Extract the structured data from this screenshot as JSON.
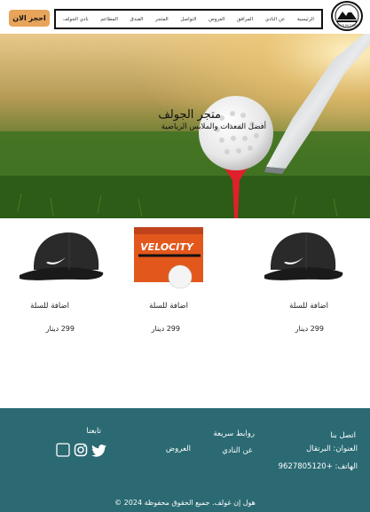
{
  "header": {
    "nav": [
      "الرئيسية",
      "عن النادي",
      "المرافق",
      "العروض",
      "التواصل",
      "المتجر",
      "الفندق",
      "المطاعم",
      "نادي الجولف"
    ],
    "book_label": "احجز الان",
    "book_color": "#e7a45a"
  },
  "hero": {
    "title": "متجر الجولف",
    "subtitle": "أفضل المعدات والملابس الرياضية"
  },
  "products": [
    {
      "image": "golf-cap",
      "add_label": "اضافة للسلة",
      "price": "299 دينار"
    },
    {
      "image": "golf-balls-box",
      "add_label": "اضافة للسلة",
      "price": "299 دينار"
    },
    {
      "image": "golf-cap",
      "add_label": "اضافة للسلة",
      "price": "299 دينار"
    }
  ],
  "footer": {
    "bg_color": "#2b6a73",
    "contact": {
      "title": "اتصل بنا",
      "address": "العنوان: البرتقال",
      "phone": "الهاتف: +9627805120"
    },
    "links": {
      "title": "روابط سريعة",
      "about": "عن النادي",
      "offers": "العروض"
    },
    "follow": {
      "title": "تابعنا",
      "icons": [
        "twitter-icon",
        "instagram-icon",
        "square-icon"
      ]
    },
    "copyright": "هول إن غولف. جميع الحقوق محفوظة 2024 ©"
  }
}
